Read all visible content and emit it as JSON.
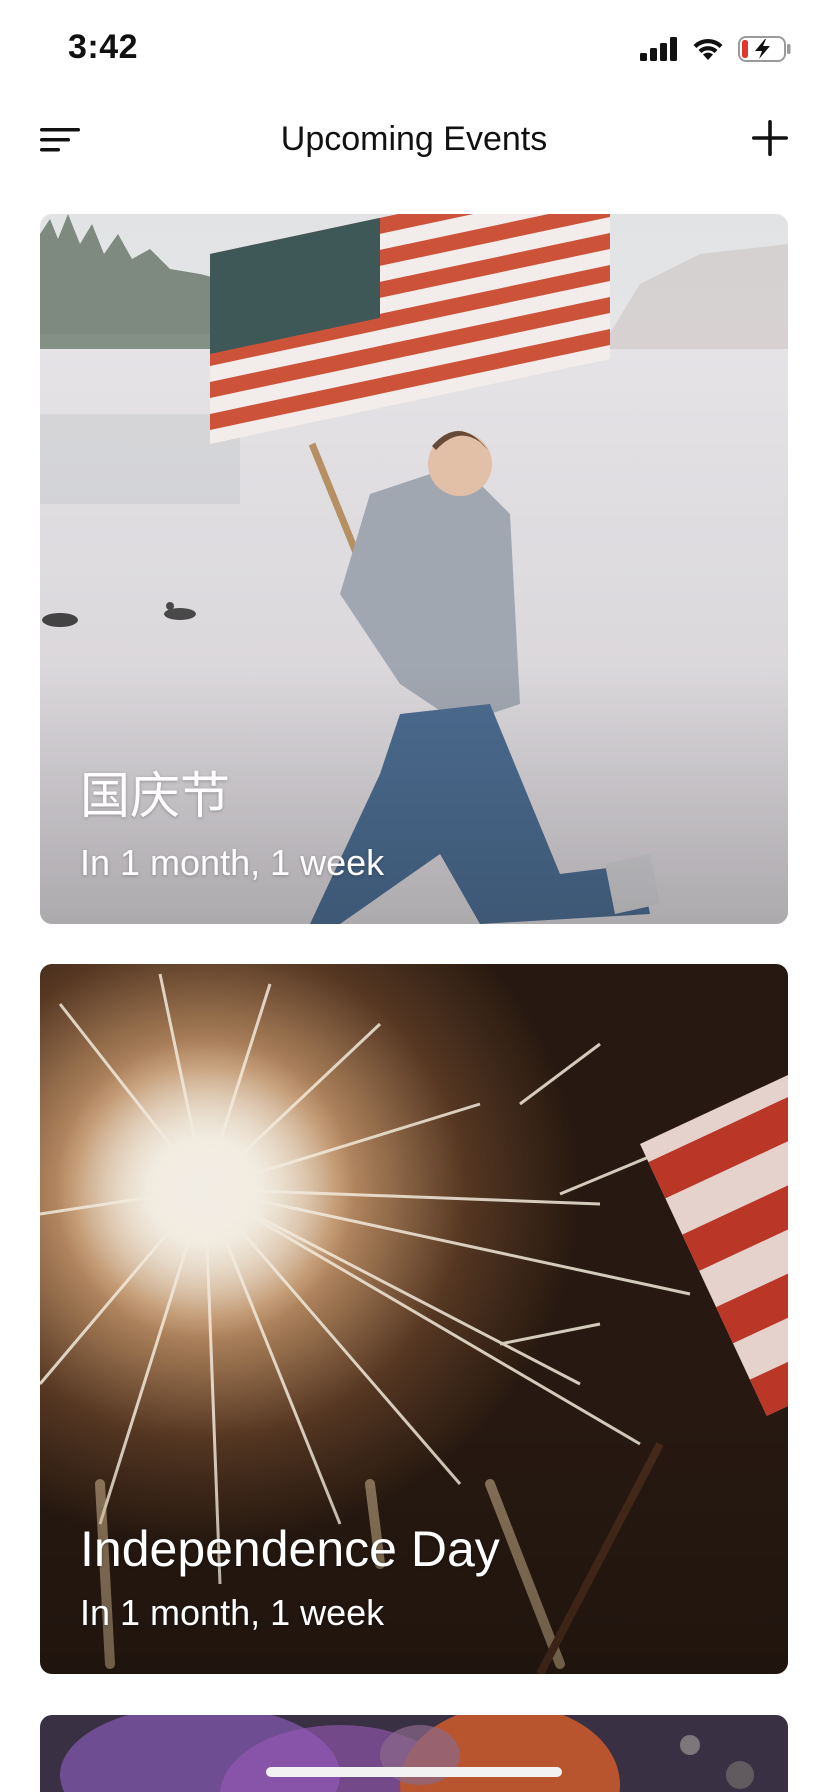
{
  "status_bar": {
    "time": "3:42",
    "icons": [
      "cellular-signal-icon",
      "wifi-icon",
      "battery-charging-icon"
    ]
  },
  "nav": {
    "title": "Upcoming Events",
    "left_icon": "menu-icon",
    "right_icon": "plus-icon"
  },
  "events": [
    {
      "title": "国庆节",
      "subtitle": "In 1 month, 1 week",
      "image": "man-jumping-with-american-flag-by-lake"
    },
    {
      "title": "Independence Day",
      "subtitle": "In 1 month, 1 week",
      "image": "sparklers-with-american-flag"
    },
    {
      "title": "",
      "subtitle": "",
      "image": "pumpkins-purple-smoke"
    }
  ],
  "colors": {
    "background": "#ffffff",
    "text": "#111111",
    "card_text": "#ffffff",
    "battery_low": "#e0382e"
  }
}
